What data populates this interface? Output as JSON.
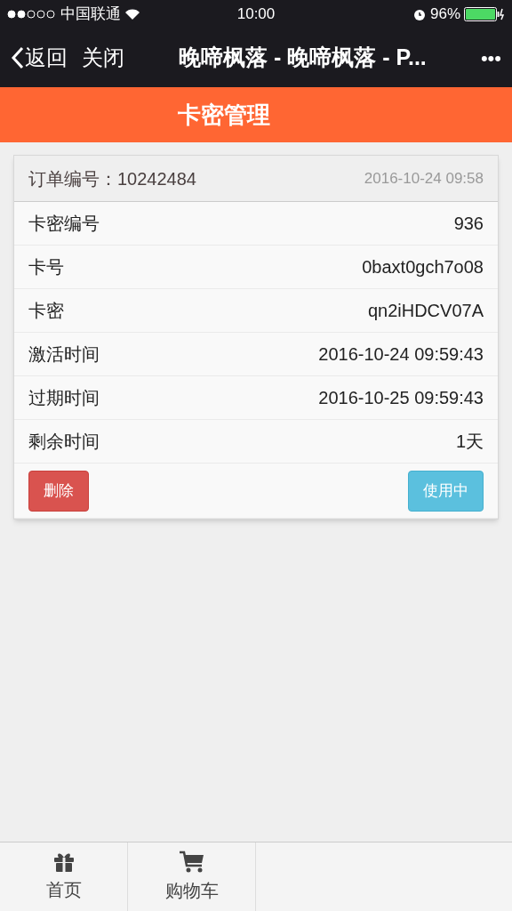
{
  "status_bar": {
    "carrier": "中国联通",
    "time": "10:00",
    "battery": "96%"
  },
  "nav": {
    "back": "返回",
    "close": "关闭",
    "title": "晚啼枫落 - 晚啼枫落 - P...",
    "more": "•••"
  },
  "header": {
    "title": "卡密管理"
  },
  "card": {
    "order": "订单编号：10242484",
    "date": "2016-10-24 09:58",
    "rows": [
      {
        "label": "卡密编号",
        "value": "936"
      },
      {
        "label": "卡号",
        "value": "0baxt0gch7o08"
      },
      {
        "label": "卡密",
        "value": "qn2iHDCV07A"
      },
      {
        "label": "激活时间",
        "value": "2016-10-24 09:59:43"
      },
      {
        "label": "过期时间",
        "value": "2016-10-25 09:59:43"
      },
      {
        "label": "剩余时间",
        "value": "1天"
      }
    ],
    "delete_button": "删除",
    "status_button": "使用中"
  },
  "tab_bar": [
    {
      "label": "首页",
      "kind": "gift"
    },
    {
      "label": "购物车",
      "kind": "cart"
    }
  ]
}
